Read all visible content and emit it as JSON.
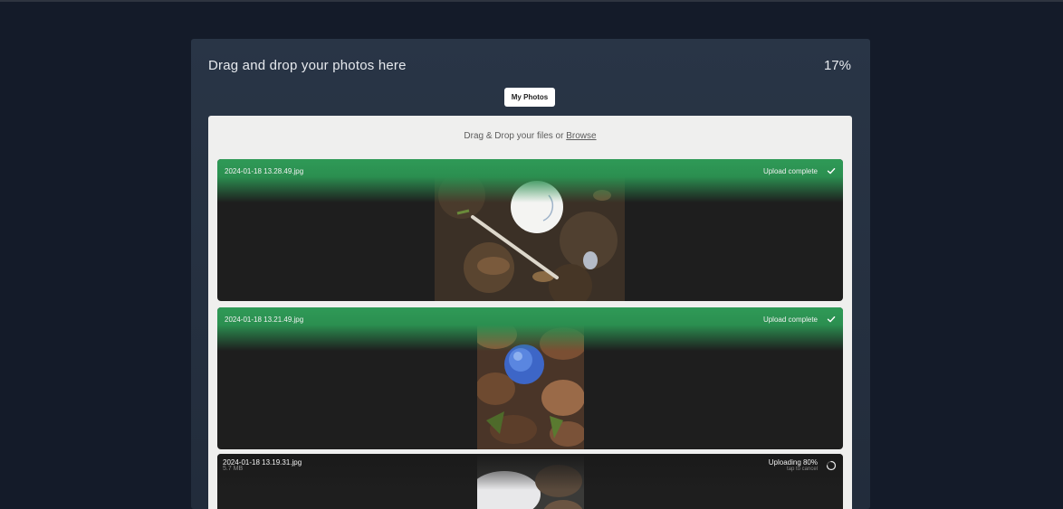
{
  "header": {
    "title": "Drag and drop your photos here",
    "progress_label": "17%",
    "progress_fraction": 0.17
  },
  "toolbar": {
    "my_photos_label": "My Photos"
  },
  "dropzone": {
    "hint_prefix": "Drag & Drop your files or",
    "browse_label": "Browse"
  },
  "files": [
    {
      "name": "2024-01-18 13.28.49.jpg",
      "status": "Upload complete",
      "status_icon": "check-icon"
    },
    {
      "name": "2024-01-18 13.21.49.jpg",
      "status": "Upload complete",
      "status_icon": "check-icon"
    },
    {
      "name": "2024-01-18 13.19.31.jpg",
      "size": "5.7 MB",
      "status": "Uploading 80%",
      "progress_fraction": 0.8,
      "cancel_hint": "tap to cancel",
      "status_icon": "spinner-icon"
    }
  ],
  "colors": {
    "background": "#141b29",
    "panel": "#293546",
    "dropzone": "#efefee",
    "complete_green": "#2f9a57",
    "card_dark": "#1e1e1e"
  }
}
